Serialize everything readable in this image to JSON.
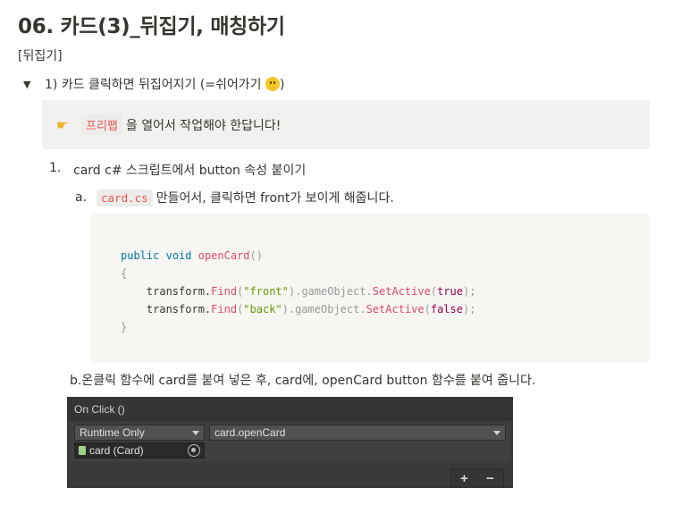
{
  "page": {
    "title": "06. 카드(3)_뒤집기, 매칭하기",
    "section_label": "[뒤집기]"
  },
  "toggle": {
    "arrow": "▼",
    "text": "1) 카드 클릭하면 뒤집어지기 (=쉬어가기 ",
    "text_end": ")",
    "emoji_icon": "slightly-smiling-face-icon"
  },
  "callout": {
    "icon": "pointing-hand-icon",
    "code": "프리팹",
    "text": "을 열어서 작업해야 한답니다!"
  },
  "list": {
    "item1_num": "1.",
    "item1_text": "card c# 스크립트에서 button 속성 붙이기",
    "item_a_num": "a.",
    "item_a_code": "card.cs",
    "item_a_text": "만들어서, 클릭하면 front가 보이게 해줍니다.",
    "item_b_text": "b.온클릭 함수에 card를 붙여 넣은 후, card에, openCard button 함수를 붙여 줍니다."
  },
  "code": {
    "l1_kw1": "public",
    "l1_kw2": "void",
    "l1_fn": "openCard",
    "l1_punc": "()",
    "l2": "{",
    "l3_obj": "transform.",
    "l3_find": "Find",
    "l3_open": "(",
    "l3_str": "\"front\"",
    "l3_mid": ").gameObject.",
    "l3_set": "SetActive",
    "l3_open2": "(",
    "l3_bool": "true",
    "l3_end": ");",
    "l4_obj": "transform.",
    "l4_find": "Find",
    "l4_open": "(",
    "l4_str": "\"back\"",
    "l4_mid": ").gameObject.",
    "l4_set": "SetActive",
    "l4_open2": "(",
    "l4_bool": "false",
    "l4_end": ");",
    "l5": "}"
  },
  "unity": {
    "header": "On Click ()",
    "runtime_select": "Runtime Only",
    "function_select": "card.openCard",
    "object_field": "card (Card)",
    "plus": "+",
    "minus": "−"
  }
}
